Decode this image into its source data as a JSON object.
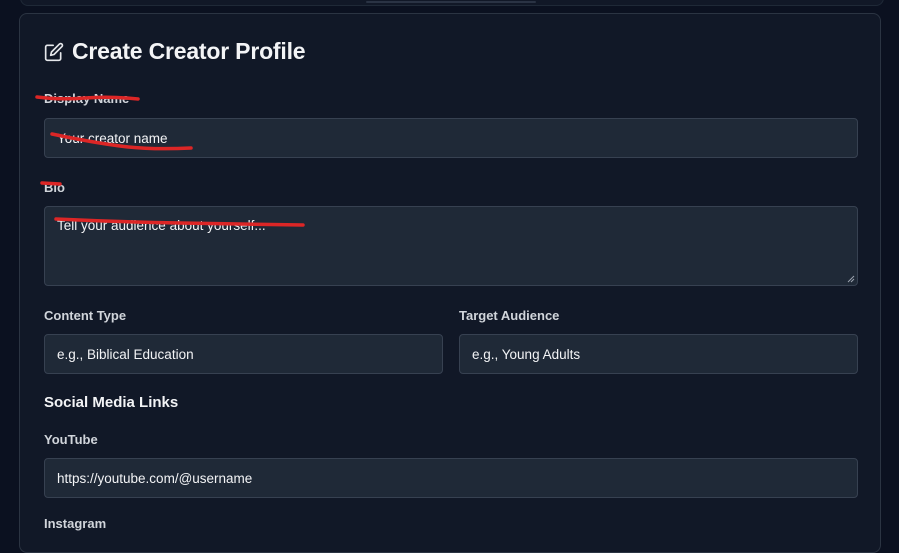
{
  "form": {
    "title": "Create Creator Profile",
    "title_icon": "edit-icon",
    "display_name": {
      "label": "Display Name",
      "placeholder": "Your creator name"
    },
    "bio": {
      "label": "Bio",
      "placeholder": "Tell your audience about yourself..."
    },
    "content_type": {
      "label": "Content Type",
      "placeholder": "e.g., Biblical Education"
    },
    "target_audience": {
      "label": "Target Audience",
      "placeholder": "e.g., Young Adults"
    },
    "social_section_title": "Social Media Links",
    "youtube": {
      "label": "YouTube",
      "placeholder": "https://youtube.com/@username"
    },
    "instagram": {
      "label": "Instagram"
    }
  },
  "colors": {
    "background": "#0b1120",
    "card": "#111827",
    "input": "#1f2937",
    "input_border": "#374151",
    "annotation_red": "#dc2626"
  }
}
